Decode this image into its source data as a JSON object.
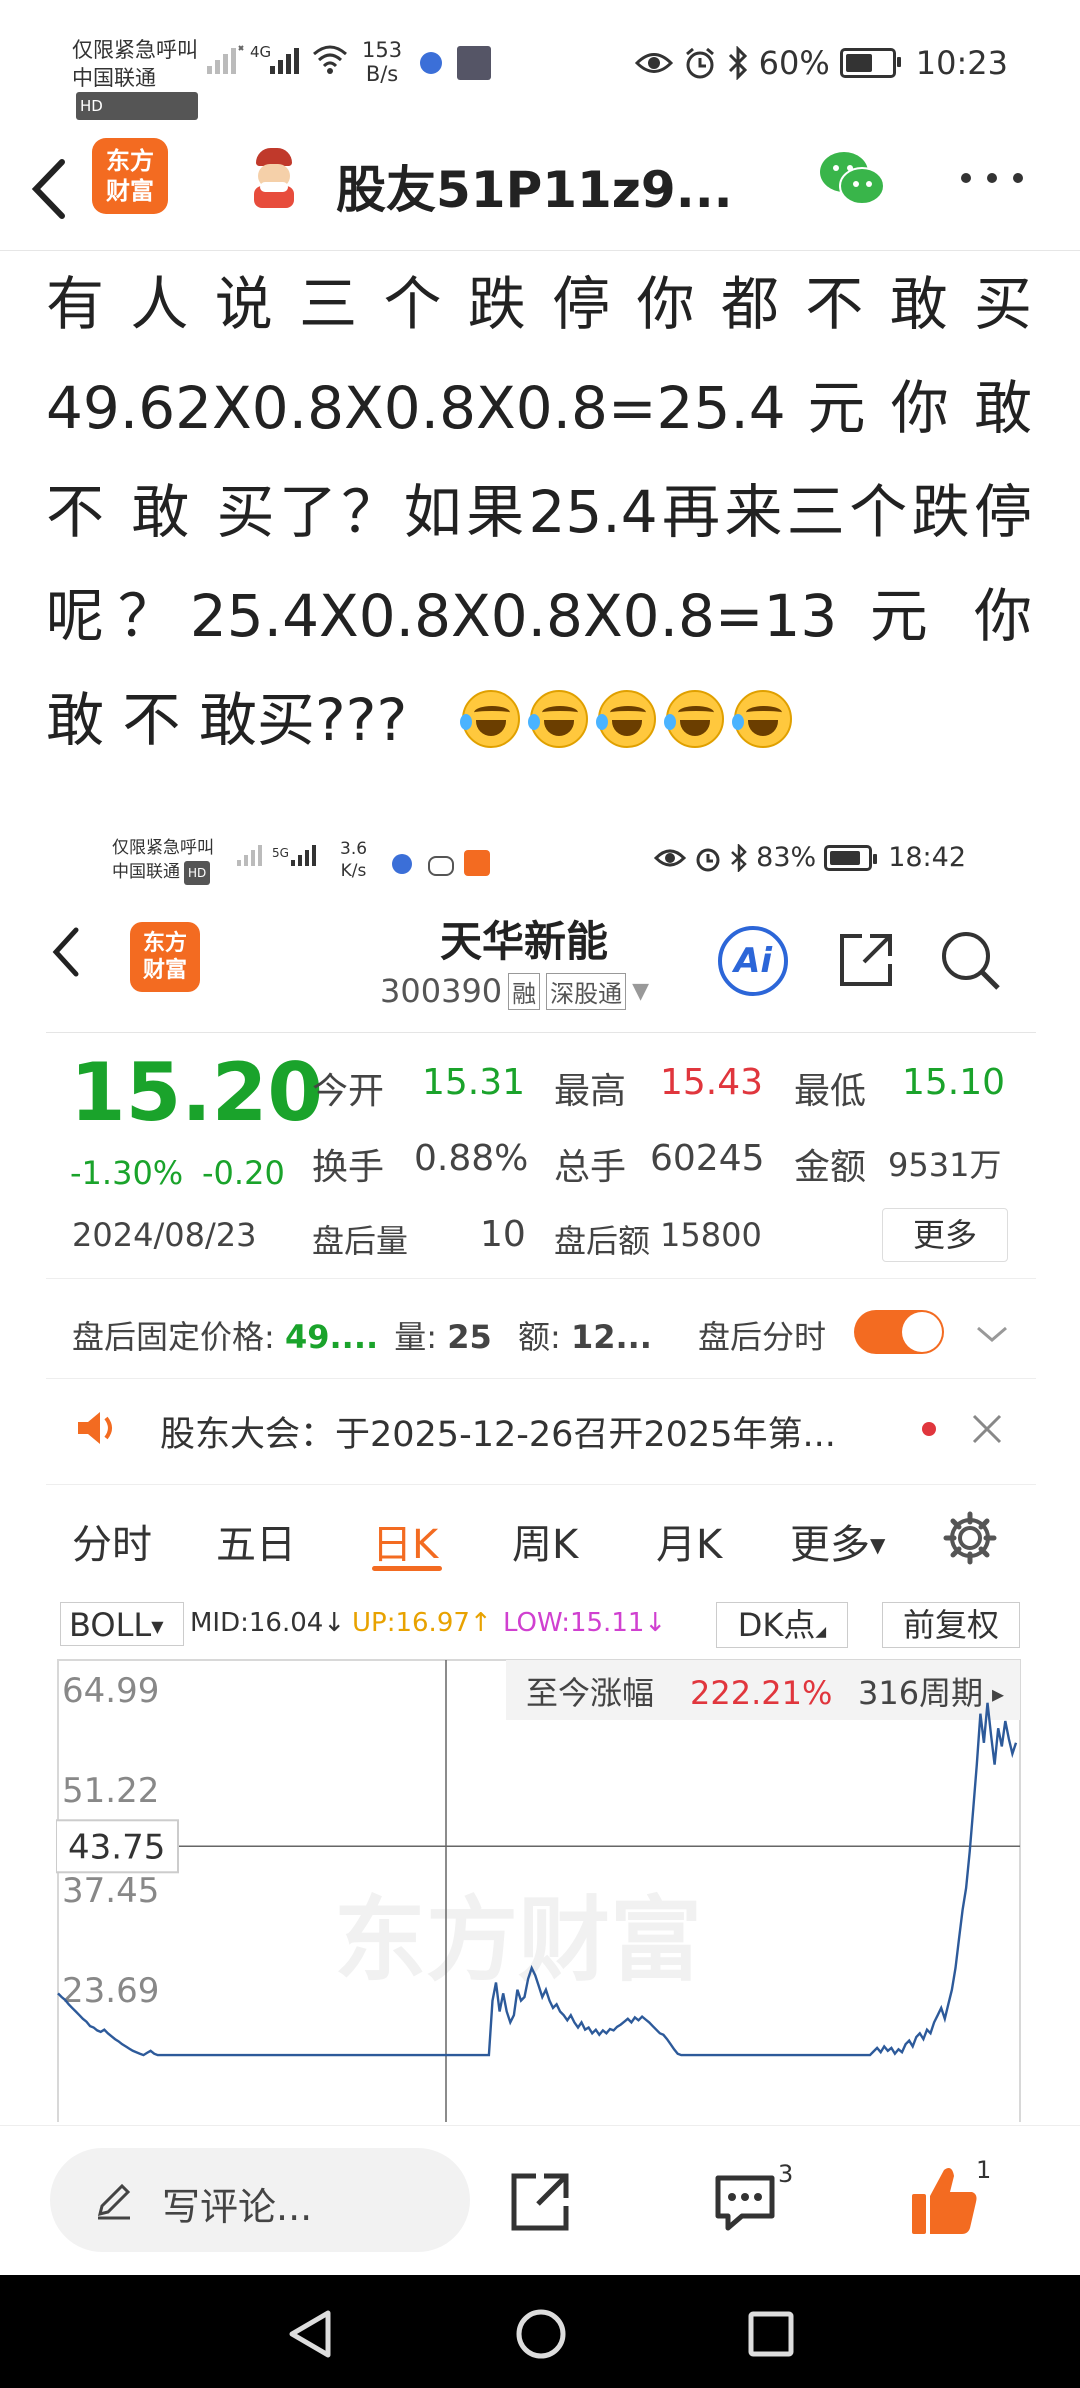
{
  "status_bar": {
    "carrier_line1": "仅限紧急呼叫",
    "carrier_line2": "中国联通",
    "hd": "HD",
    "net_type": "4G",
    "speed_value": "153",
    "speed_unit": "B/s",
    "battery": "60%",
    "time": "10:23"
  },
  "header": {
    "logo_text_1": "东方",
    "logo_text_2": "财富",
    "username": "股友51P11z9..."
  },
  "post": {
    "text": "有人说三个跌停你都不敢买49.62X0.8X0.8X0.8=25.4 元 你 敢 不 敢 买了？如果25.4再来三个跌停呢？25.4X0.8X0.8X0.8=13 元 你 敢 不 敢买???"
  },
  "inner": {
    "status_bar": {
      "carrier_line1": "仅限紧急呼叫",
      "carrier_line2": "中国联通",
      "hd": "HD",
      "net_type": "5G",
      "speed_value": "3.6",
      "speed_unit": "K/s",
      "battery": "83%",
      "time": "18:42"
    },
    "stock": {
      "name": "天华新能",
      "code": "300390",
      "tag1": "融",
      "tag2": "深股通",
      "ai": "Ai",
      "price": "15.20",
      "change_pct": "-1.30%",
      "change_abs": "-0.20",
      "date": "2024/08/23",
      "open_label": "今开",
      "open": "15.31",
      "high_label": "最高",
      "high": "15.43",
      "low_label": "最低",
      "low": "15.10",
      "turnover_label": "换手",
      "turnover": "0.88%",
      "volume_label": "总手",
      "volume": "60245",
      "amount_label": "金额",
      "amount": "9531万",
      "after_vol_label": "盘后量",
      "after_vol": "10",
      "after_amt_label": "盘后额",
      "after_amt": "15800",
      "more_button": "更多",
      "fixed_price_label": "盘后固定价格:",
      "fixed_price": "49....",
      "qty_label": "量:",
      "qty": "25",
      "amt2_label": "额:",
      "amt2": "12...",
      "after_timeline_label": "盘后分时"
    },
    "notice": "股东大会：于2025-12-26召开2025年第...",
    "tabs": [
      "分时",
      "五日",
      "日K",
      "周K",
      "月K",
      "更多"
    ],
    "indicator": {
      "name": "BOLL",
      "mid": "MID:16.04",
      "up": "UP:16.97",
      "low": "LOW:15.11",
      "dk": "DK点",
      "adjust": "前复权"
    },
    "chart_data": {
      "type": "line",
      "y_ticks": [
        "64.99",
        "51.22",
        "37.45",
        "23.69"
      ],
      "crosshair_value": "43.75",
      "banner_label": "至今涨幅",
      "banner_value": "222.21%",
      "banner_period": "316周期",
      "watermark": "东方财富",
      "ylim": [
        15,
        64.99
      ],
      "series": [
        {
          "values": [
            23.5,
            23.0,
            22.6,
            22.0,
            21.5,
            21.0,
            20.5,
            20.0,
            19.6,
            19.0,
            18.8,
            18.4,
            18.2,
            18.5,
            18.0,
            17.6,
            17.2,
            16.9,
            16.5,
            16.2,
            15.9,
            15.6,
            15.4,
            15.2,
            15.0,
            15.3,
            15.6,
            15.2,
            15.0,
            15.0,
            15.0,
            15.0,
            15.0,
            15.0,
            15.0,
            15.0,
            15.0,
            15.0,
            15.0,
            15.0,
            15.0,
            15.0,
            15.0,
            15.0,
            15.0,
            15.0,
            15.0,
            15.0,
            15.0,
            15.0,
            15.0,
            15.0,
            15.0,
            15.0,
            15.0,
            15.0,
            15.0,
            15.0,
            15.0,
            15.0,
            15.0,
            15.0,
            15.0,
            15.0,
            15.0,
            15.0,
            15.0,
            15.0,
            15.0,
            15.0,
            15.0,
            15.0,
            15.0,
            15.0,
            15.0,
            15.0,
            15.0,
            15.0,
            15.0,
            15.0,
            15.0,
            15.0,
            15.0,
            15.0,
            15.0,
            15.0,
            15.0,
            15.0,
            15.0,
            15.0,
            15.0,
            15.0,
            15.0,
            15.0,
            15.0,
            15.0,
            15.0,
            15.0,
            15.0,
            15.0,
            15.0,
            15.0,
            15.0,
            15.0,
            15.0,
            15.0,
            15.0,
            15.0,
            15.0,
            15.0,
            15.0,
            15.0,
            15.0,
            15.0,
            15.0,
            15.0,
            15.0,
            15.0,
            15.0,
            15.0,
            15.0,
            15.0,
            22.5,
            25.0,
            21.0,
            23.5,
            21.0,
            19.5,
            20.5,
            24.0,
            22.5,
            23.0,
            25.5,
            27.0,
            26.0,
            24.5,
            23.0,
            24.0,
            22.5,
            21.5,
            22.0,
            21.0,
            20.5,
            19.8,
            20.5,
            19.5,
            18.8,
            19.5,
            18.5,
            18.8,
            18.0,
            18.5,
            17.8,
            18.4,
            18.0,
            18.6,
            18.4,
            18.9,
            19.2,
            19.6,
            20.0,
            19.5,
            20.2,
            19.8,
            20.3,
            19.9,
            19.5,
            19.0,
            18.5,
            18.0,
            17.8,
            17.2,
            16.5,
            15.8,
            15.2,
            15.0,
            15.0,
            15.0,
            15.0,
            15.0,
            15.0,
            15.0,
            15.0,
            15.0,
            15.0,
            15.0,
            15.0,
            15.0,
            15.0,
            15.0,
            15.0,
            15.0,
            15.0,
            15.0,
            15.0,
            15.0,
            15.0,
            15.0,
            15.0,
            15.0,
            15.0,
            15.0,
            15.0,
            15.0,
            15.0,
            15.0,
            15.0,
            15.0,
            15.0,
            15.0,
            15.0,
            15.0,
            15.0,
            15.0,
            15.0,
            15.0,
            15.0,
            15.0,
            15.0,
            15.0,
            15.0,
            15.0,
            15.0,
            15.0,
            15.0,
            15.0,
            15.0,
            15.0,
            15.0,
            15.5,
            16.0,
            15.4,
            16.2,
            15.6,
            16.0,
            15.2,
            15.8,
            15.4,
            16.5,
            17.0,
            16.2,
            17.5,
            18.0,
            17.2,
            18.5,
            18.0,
            19.5,
            20.5,
            21.5,
            20.0,
            22.0,
            24.0,
            27.0,
            31.0,
            35.0,
            38.0,
            43.0,
            49.0,
            55.0,
            62.0,
            58.0,
            63.5,
            59.0,
            55.0,
            60.0,
            57.5,
            61.0,
            58.5,
            56.5,
            58.0
          ]
        }
      ]
    }
  },
  "bottom": {
    "comment_placeholder": "写评论...",
    "comment_badge": "3",
    "like_badge": "1"
  },
  "colors": {
    "brand": "#f36b21",
    "up_red": "#e0363d",
    "down_green": "#1aa32b",
    "line_blue": "#2d5a9a",
    "wechat_green": "#39b54a"
  }
}
